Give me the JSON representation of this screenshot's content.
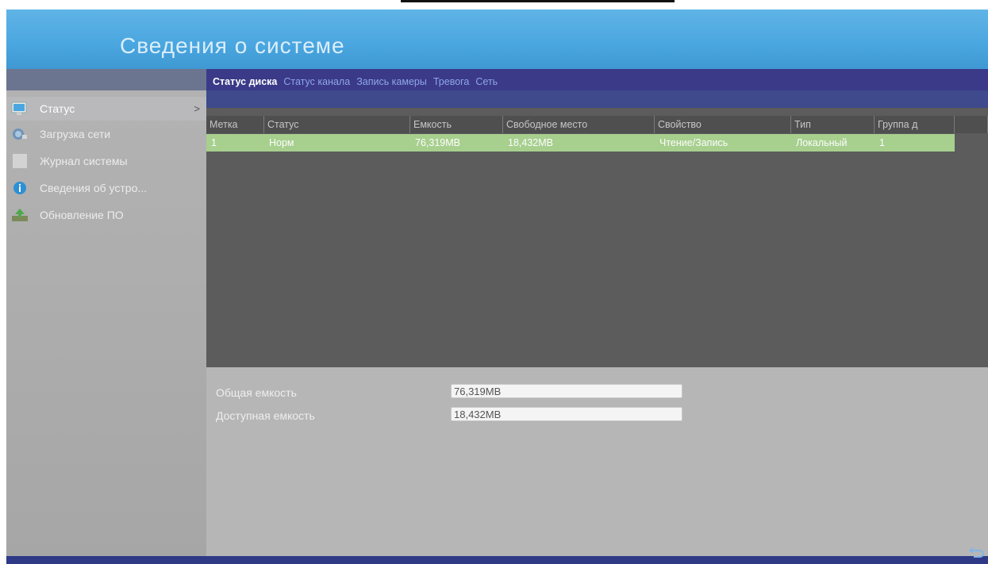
{
  "header": {
    "title": "Сведения о системе"
  },
  "sidebar": {
    "items": [
      {
        "label": "Статус",
        "icon": "monitor-icon"
      },
      {
        "label": "Загрузка сети",
        "icon": "network-icon"
      },
      {
        "label": "Журнал системы",
        "icon": "log-icon"
      },
      {
        "label": "Сведения об устро...",
        "icon": "info-icon"
      },
      {
        "label": "Обновление ПО",
        "icon": "upgrade-icon"
      }
    ],
    "active_arrow": ">"
  },
  "tabs": [
    {
      "label": "Статус диска"
    },
    {
      "label": "Статус канала"
    },
    {
      "label": "Запись камеры"
    },
    {
      "label": "Тревога"
    },
    {
      "label": "Сеть"
    }
  ],
  "table": {
    "columns": [
      "Метка",
      "Статус",
      "Емкость",
      "Свободное место",
      "Свойство",
      "Тип",
      "Группа д"
    ],
    "rows": [
      {
        "label": "1",
        "status": "Норм",
        "capacity": "76,319MB",
        "free": "18,432MB",
        "property": "Чтение/Запись",
        "type": "Локальный",
        "group": "1"
      }
    ]
  },
  "summary": {
    "total_label": "Общая емкость",
    "total_value": "76,319MB",
    "available_label": "Доступная емкость",
    "available_value": "18,432MB"
  },
  "colors": {
    "header": "#4aa6df",
    "tabbar": "#3a3a88",
    "row_highlight": "#a7cf8e"
  }
}
